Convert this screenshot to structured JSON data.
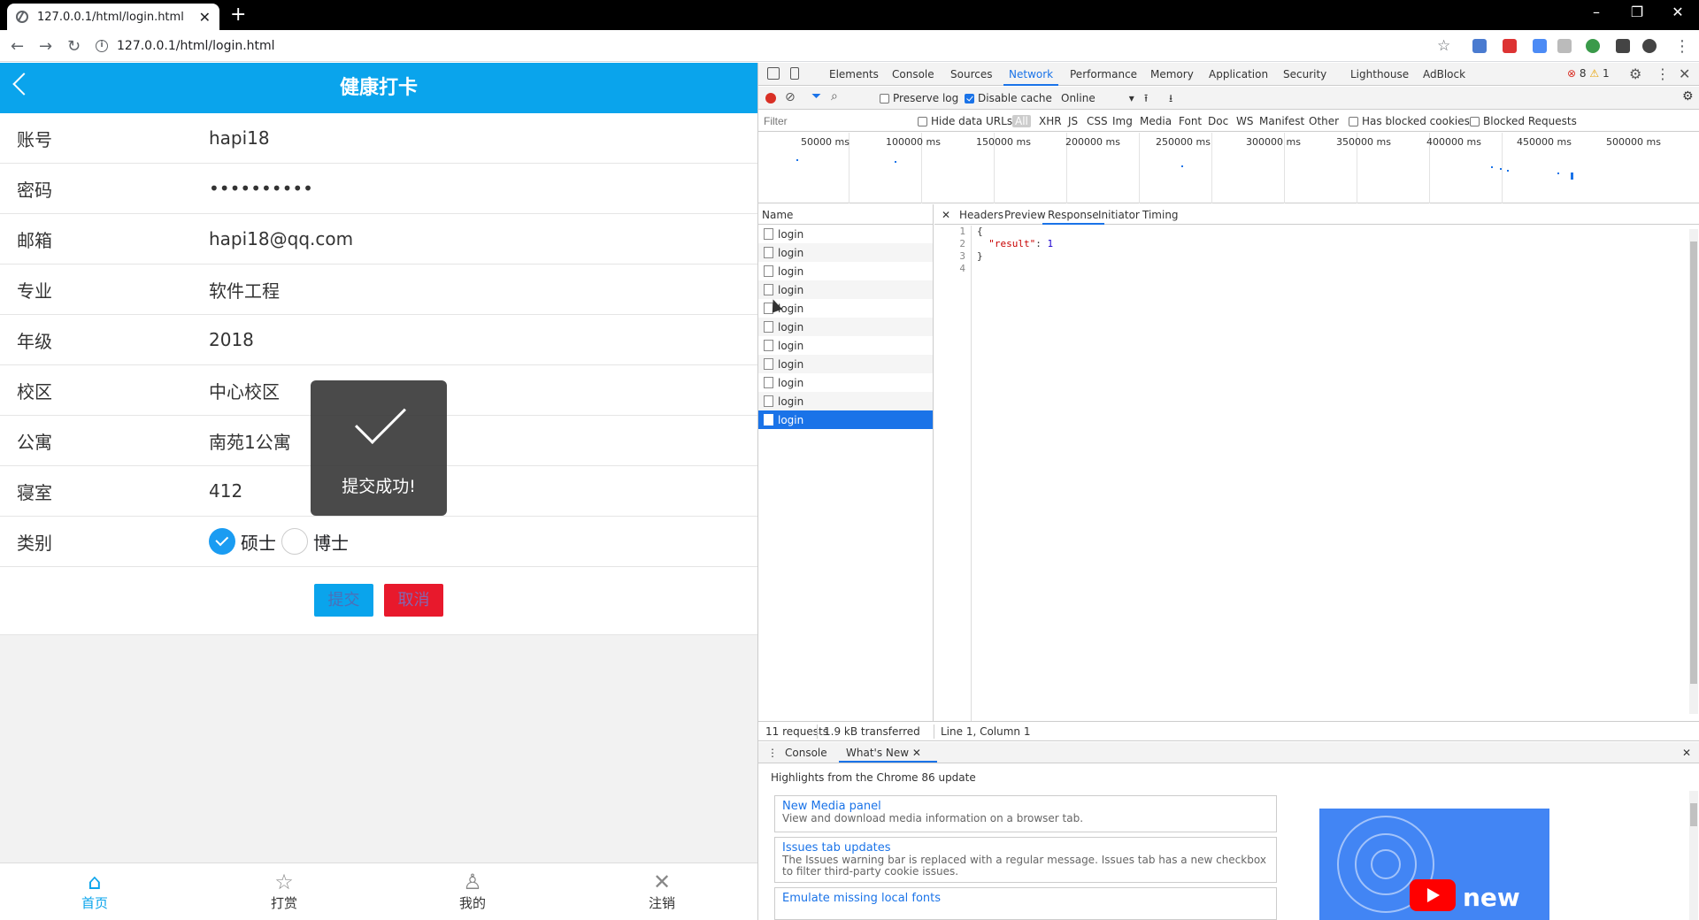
{
  "browser": {
    "tab_title": "127.0.0.1/html/login.html",
    "url": "127.0.0.1/html/login.html"
  },
  "app": {
    "title": "健康打卡",
    "fields": [
      {
        "label": "账号",
        "value": "hapi18"
      },
      {
        "label": "密码",
        "value": "••••••••••"
      },
      {
        "label": "邮箱",
        "value": "hapi18@qq.com"
      },
      {
        "label": "专业",
        "value": "软件工程"
      },
      {
        "label": "年级",
        "value": "2018"
      },
      {
        "label": "校区",
        "value": "中心校区"
      },
      {
        "label": "公寓",
        "value": "南苑1公寓"
      },
      {
        "label": "寝室",
        "value": "412"
      }
    ],
    "category": {
      "label": "类别",
      "option1": "硕士",
      "option2": "博士",
      "selected": "硕士"
    },
    "submit_label": "提交",
    "cancel_label": "取消",
    "toast": "提交成功!",
    "bottom_nav": [
      {
        "label": "首页",
        "icon": "home-icon"
      },
      {
        "label": "打赏",
        "icon": "star-icon"
      },
      {
        "label": "我的",
        "icon": "user-icon"
      },
      {
        "label": "注销",
        "icon": "close-icon"
      }
    ]
  },
  "devtools": {
    "tabs": [
      "Elements",
      "Console",
      "Sources",
      "Network",
      "Performance",
      "Memory",
      "Application",
      "Security",
      "Lighthouse",
      "AdBlock"
    ],
    "active_tab": "Network",
    "errors": "8",
    "warnings": "1",
    "toolbar": {
      "preserve_log": "Preserve log",
      "disable_cache": "Disable cache",
      "throttle": "Online"
    },
    "filter": {
      "placeholder": "Filter",
      "hide_data_urls": "Hide data URLs",
      "types": [
        "All",
        "XHR",
        "JS",
        "CSS",
        "Img",
        "Media",
        "Font",
        "Doc",
        "WS",
        "Manifest",
        "Other"
      ],
      "has_blocked_cookies": "Has blocked cookies",
      "blocked_requests": "Blocked Requests"
    },
    "timeline_ticks": [
      "50000 ms",
      "100000 ms",
      "150000 ms",
      "200000 ms",
      "250000 ms",
      "300000 ms",
      "350000 ms",
      "400000 ms",
      "450000 ms",
      "500000 ms"
    ],
    "name_header": "Name",
    "requests": [
      "login",
      "login",
      "login",
      "login",
      "login",
      "login",
      "login",
      "login",
      "login",
      "login",
      "login"
    ],
    "selected_request_index": 10,
    "detail_tabs": [
      "Headers",
      "Preview",
      "Response",
      "Initiator",
      "Timing"
    ],
    "active_detail_tab": "Response",
    "response_lines": [
      "1",
      "2",
      "3",
      "4"
    ],
    "response_key": "\"result\"",
    "response_value": "1",
    "status": {
      "requests": "11 requests",
      "transferred": "1.9 kB transferred",
      "cursor": "Line 1, Column 1"
    },
    "drawer": {
      "tabs": [
        "Console",
        "What's New"
      ],
      "highlights": "Highlights from the Chrome 86 update",
      "cards": [
        {
          "title": "New Media panel",
          "desc": "View and download media information on a browser tab."
        },
        {
          "title": "Issues tab updates",
          "desc": "The Issues warning bar is replaced with a regular message. Issues tab has a new checkbox to filter third-party cookie issues."
        },
        {
          "title": "Emulate missing local fonts",
          "desc": ""
        }
      ],
      "promo_text": "new"
    }
  }
}
